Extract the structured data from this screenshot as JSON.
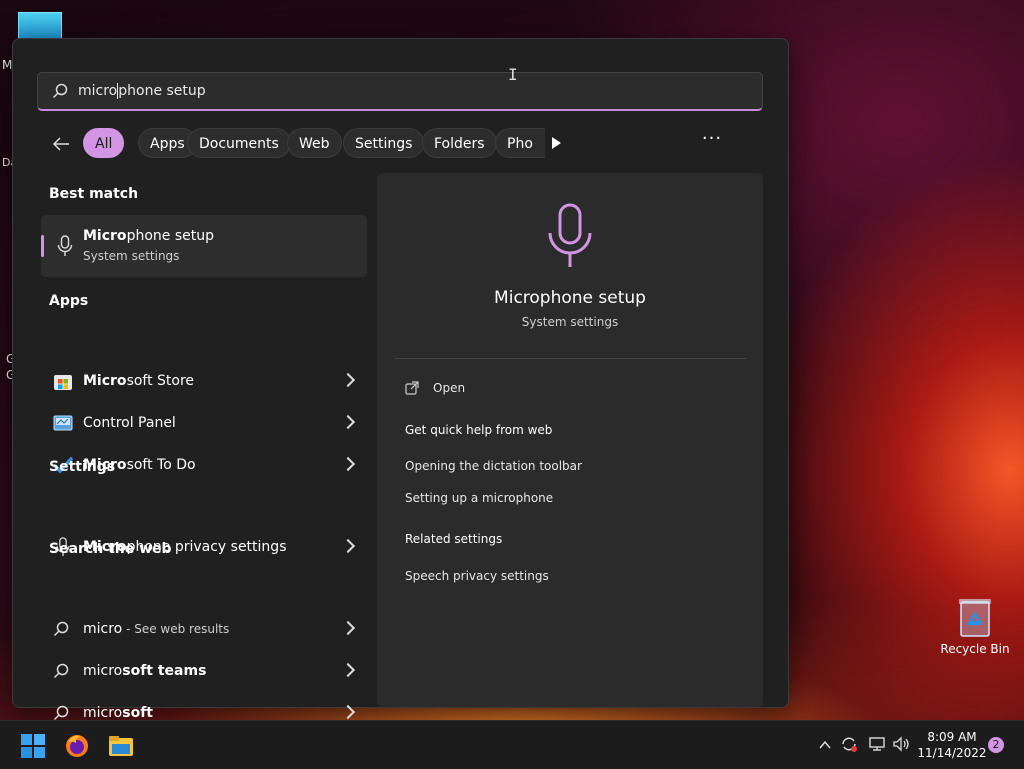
{
  "search": {
    "query_prefix": "micro",
    "query_suffix": "phone setup"
  },
  "filters": {
    "chips": [
      "All",
      "Apps",
      "Documents",
      "Web",
      "Settings",
      "Folders",
      "Pho"
    ],
    "more": "···"
  },
  "left": {
    "best_match_header": "Best match",
    "best": {
      "bold": "Micro",
      "rest": "phone setup",
      "sub": "System settings"
    },
    "apps_header": "Apps",
    "apps": [
      {
        "bold": "Micro",
        "rest": "soft Store",
        "icon": "microsoft-store-icon"
      },
      {
        "bold": "",
        "rest": "Control Panel",
        "icon": "control-panel-icon"
      },
      {
        "bold": "Micro",
        "rest": "soft To Do",
        "icon": "todo-check-icon"
      }
    ],
    "settings_header": "Settings",
    "settings": [
      {
        "bold": "Micro",
        "rest": "phone privacy settings",
        "icon": "microphone-icon"
      }
    ],
    "web_header": "Search the web",
    "web": [
      {
        "main": "micro",
        "rest": "",
        "sub": " - See web results"
      },
      {
        "main": "micro",
        "rest": "soft teams",
        "sub": ""
      },
      {
        "main": "micro",
        "rest": "soft",
        "sub": ""
      }
    ]
  },
  "right": {
    "title": "Microphone setup",
    "subtitle": "System settings",
    "open": "Open",
    "quick_help_header": "Get quick help from web",
    "help_links": [
      "Opening the dictation toolbar",
      "Setting up a microphone"
    ],
    "related_header": "Related settings",
    "related_links": [
      "Speech privacy settings"
    ]
  },
  "desktop": {
    "recycle_bin": "Recycle Bin",
    "frag_m": "M",
    "frag_d": "Da",
    "frag_g1": "G",
    "frag_g2": "G"
  },
  "taskbar": {
    "time": "8:09 AM",
    "date": "11/14/2022",
    "notifications": "2"
  },
  "colors": {
    "accent": "#d195e4",
    "panel": "#202020",
    "preview": "#2b2b2b"
  }
}
